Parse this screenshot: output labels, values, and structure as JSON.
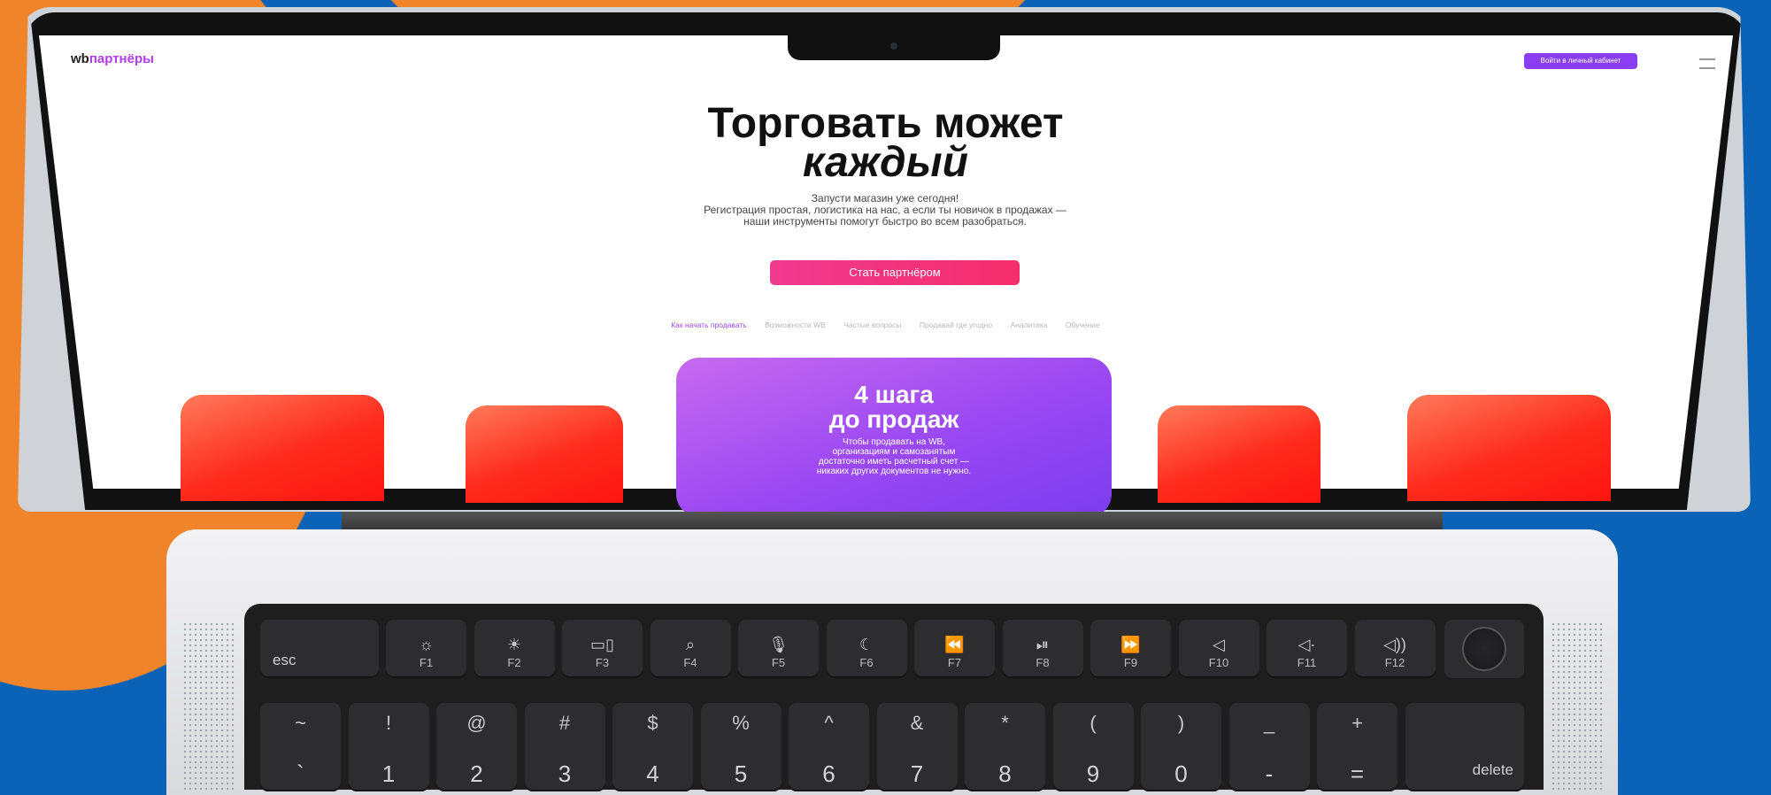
{
  "site": {
    "logo_prefix": "wb",
    "logo_suffix": "партнёры",
    "login_button": "Войти в личный кабинет",
    "hero_title_line1": "Торговать может",
    "hero_title_line2": "каждый",
    "hero_sub_line1": "Запусти магазин уже сегодня!",
    "hero_sub_line2": "Регистрация простая, логистика на нас, а если ты новичок в продажах —",
    "hero_sub_line3": "наши инструменты помогут быстро во всем разобраться.",
    "cta_button": "Стать партнёром",
    "tabs": [
      "Как начать продавать",
      "Возможности WB",
      "Частые вопросы",
      "Продавай где угодно",
      "Аналитика",
      "Обучение"
    ],
    "card_title_line1": "4 шага",
    "card_title_line2": "до продаж",
    "card_text_line1": "Чтобы продавать на WB,",
    "card_text_line2": "организациям и самозанятым",
    "card_text_line3": "достаточно иметь расчетный счет —",
    "card_text_line4": "никаких других документов не нужно."
  },
  "keyboard": {
    "fn_row": [
      {
        "label": "esc",
        "icon": ""
      },
      {
        "label": "F1",
        "icon": "☼",
        "icon_name": "brightness-down-icon"
      },
      {
        "label": "F2",
        "icon": "☀",
        "icon_name": "brightness-up-icon"
      },
      {
        "label": "F3",
        "icon": "▭▯",
        "icon_name": "mission-control-icon"
      },
      {
        "label": "F4",
        "icon": "⌕",
        "icon_name": "search-icon"
      },
      {
        "label": "F5",
        "icon": "🎙",
        "icon_name": "microphone-icon"
      },
      {
        "label": "F6",
        "icon": "☾",
        "icon_name": "moon-icon"
      },
      {
        "label": "F7",
        "icon": "⏪",
        "icon_name": "rewind-icon"
      },
      {
        "label": "F8",
        "icon": "⏯",
        "icon_name": "play-pause-icon"
      },
      {
        "label": "F9",
        "icon": "⏩",
        "icon_name": "fast-forward-icon"
      },
      {
        "label": "F10",
        "icon": "◁",
        "icon_name": "mute-icon"
      },
      {
        "label": "F11",
        "icon": "◁·",
        "icon_name": "volume-down-icon"
      },
      {
        "label": "F12",
        "icon": "◁))",
        "icon_name": "volume-up-icon"
      }
    ],
    "num_row": [
      {
        "top": "~",
        "bot": "`"
      },
      {
        "top": "!",
        "bot": "1"
      },
      {
        "top": "@",
        "bot": "2"
      },
      {
        "top": "#",
        "bot": "3"
      },
      {
        "top": "$",
        "bot": "4"
      },
      {
        "top": "%",
        "bot": "5"
      },
      {
        "top": "^",
        "bot": "6"
      },
      {
        "top": "&",
        "bot": "7"
      },
      {
        "top": "*",
        "bot": "8"
      },
      {
        "top": "(",
        "bot": "9"
      },
      {
        "top": ")",
        "bot": "0"
      },
      {
        "top": "_",
        "bot": "-"
      },
      {
        "top": "+",
        "bot": "="
      },
      {
        "label": "delete"
      }
    ]
  },
  "colors": {
    "background_blue": "#0a63b6",
    "background_orange": "#f0842a",
    "accent_purple": "#9a48f2",
    "cta_pink": "#f03a8e",
    "tile_red": "#ff2a1c"
  }
}
